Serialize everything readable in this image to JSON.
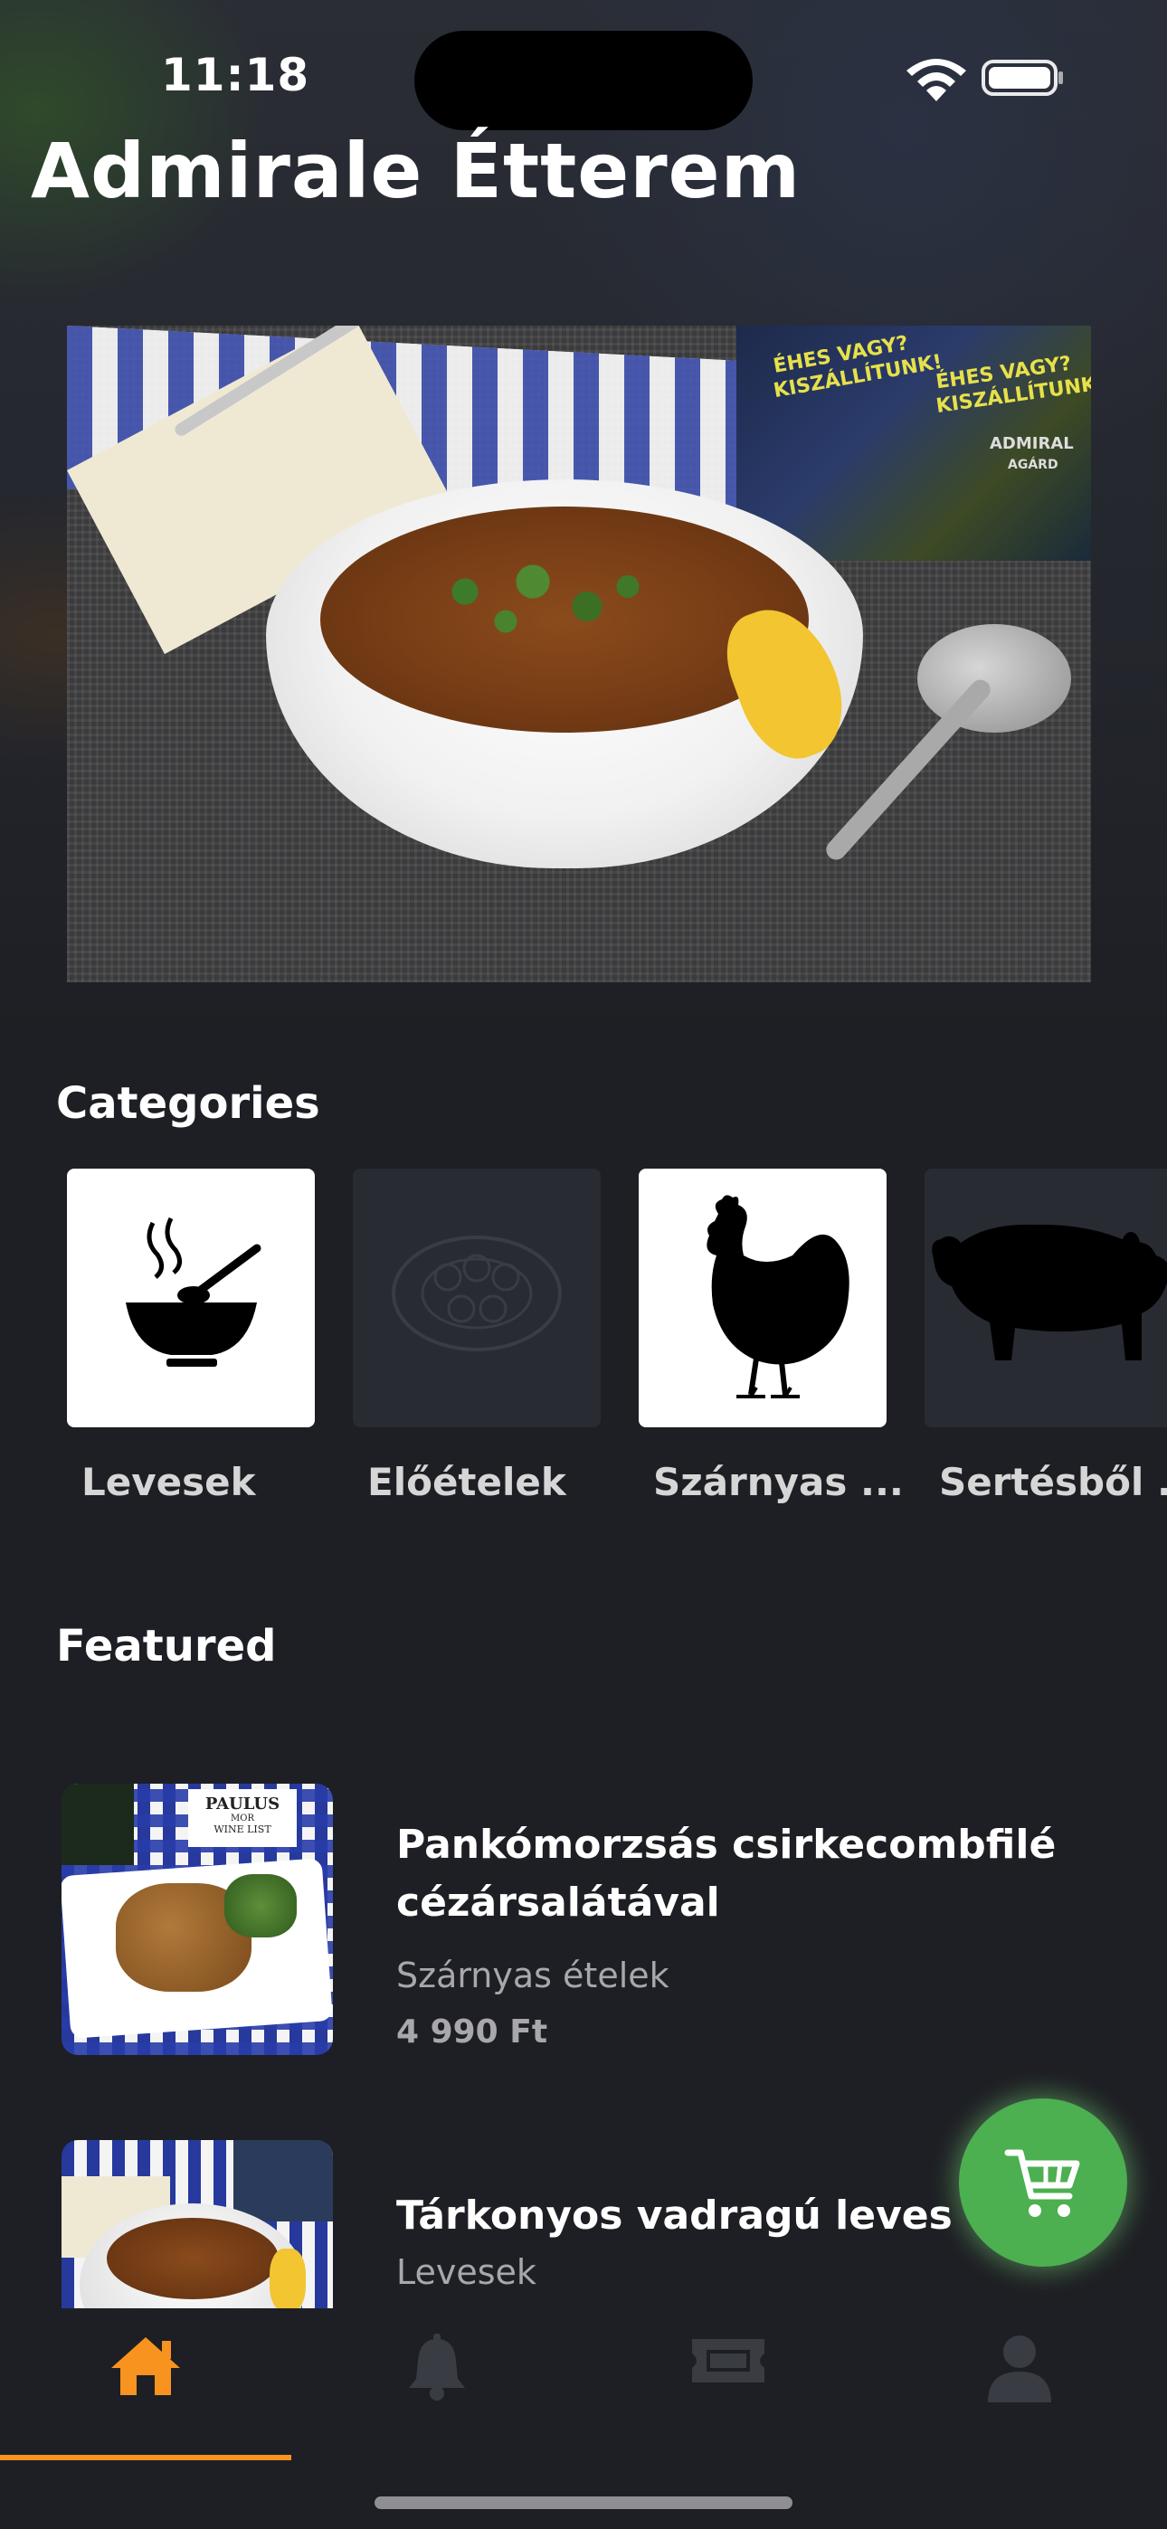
{
  "status_bar": {
    "time": "11:18",
    "wifi_icon": "wifi-icon",
    "battery_icon": "battery-icon"
  },
  "app": {
    "title": "Admirale Étterem"
  },
  "hero": {
    "image_name": "soup-bowl-photo",
    "flyer_lines": [
      "ÉHES VAGY?",
      "KISZÁLLÍTUNK!",
      "ÉHES VAGY?",
      "KISZÁLLÍTUNK!",
      "ADMIRAL",
      "AGÁRD"
    ]
  },
  "categories": {
    "title": "Categories",
    "items": [
      {
        "label": "Levesek",
        "icon": "soup-bowl-icon",
        "tile": "white"
      },
      {
        "label": "Előételek",
        "icon": "appetizer-plate-icon",
        "tile": "dark"
      },
      {
        "label": "Szárnyas ...",
        "icon": "chicken-icon",
        "tile": "white"
      },
      {
        "label": "Sertésből ...",
        "icon": "pig-icon",
        "tile": "dark"
      }
    ]
  },
  "featured": {
    "title": "Featured",
    "items": [
      {
        "name_line1": "Pankómorzsás csirkecombfilé",
        "name_line2": "cézársalátával",
        "category": "Szárnyas ételek",
        "price": "4 990 Ft",
        "thumb_text_line1": "PAULUS",
        "thumb_text_line2": "MOR",
        "thumb_text_line3": "WINE LIST"
      },
      {
        "name_line1": "Tárkonyos vadragú leves",
        "category": "Levesek"
      }
    ]
  },
  "cart_button": {
    "icon": "cart-icon",
    "color": "#4caf50"
  },
  "bottom_nav": {
    "items": [
      {
        "icon": "home-icon",
        "active": true
      },
      {
        "icon": "bell-icon",
        "active": false
      },
      {
        "icon": "ticket-icon",
        "active": false
      },
      {
        "icon": "profile-icon",
        "active": false
      }
    ],
    "active_color": "#f7931e",
    "inactive_color": "#3a3c43"
  }
}
